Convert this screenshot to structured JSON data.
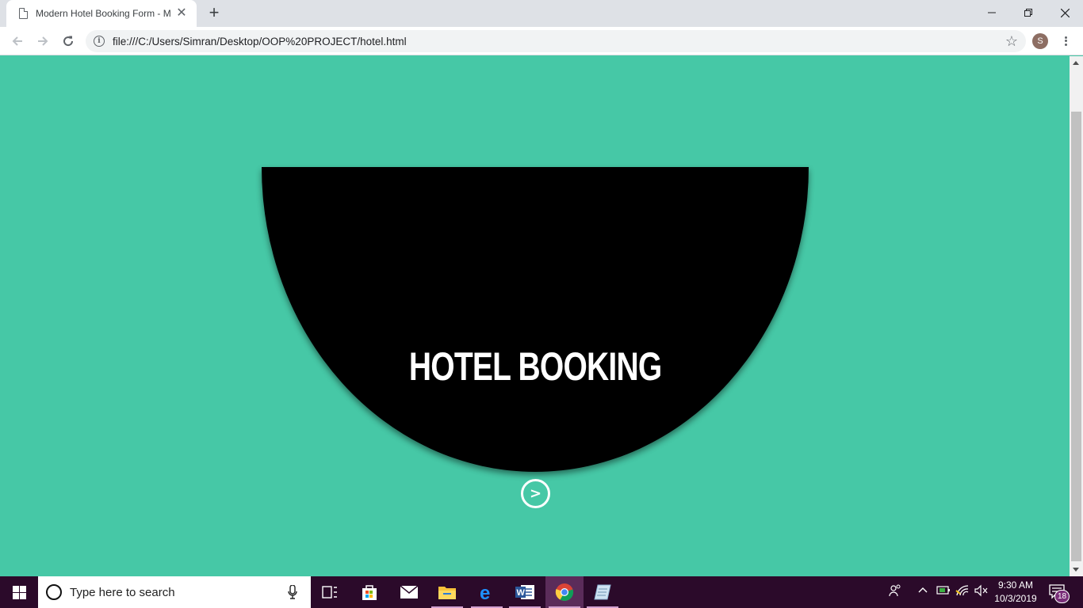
{
  "browser": {
    "tab_title": "Modern Hotel Booking Form - M",
    "tab_close": "✕",
    "new_tab": "+",
    "url": "file:///C:/Users/Simran/Desktop/OOP%20PROJECT/hotel.html",
    "profile_initial": "S"
  },
  "page": {
    "title": "HOTEL BOOKING",
    "next_button": ">",
    "background_color": "#46c8a6",
    "panel_color": "#000000"
  },
  "taskbar": {
    "search_placeholder": "Type here to search",
    "time": "9:30 AM",
    "date": "10/3/2019",
    "notification_count": "18",
    "apps": [
      "task-view",
      "microsoft-store",
      "mail",
      "file-explorer",
      "edge",
      "word",
      "chrome",
      "notepad"
    ]
  }
}
